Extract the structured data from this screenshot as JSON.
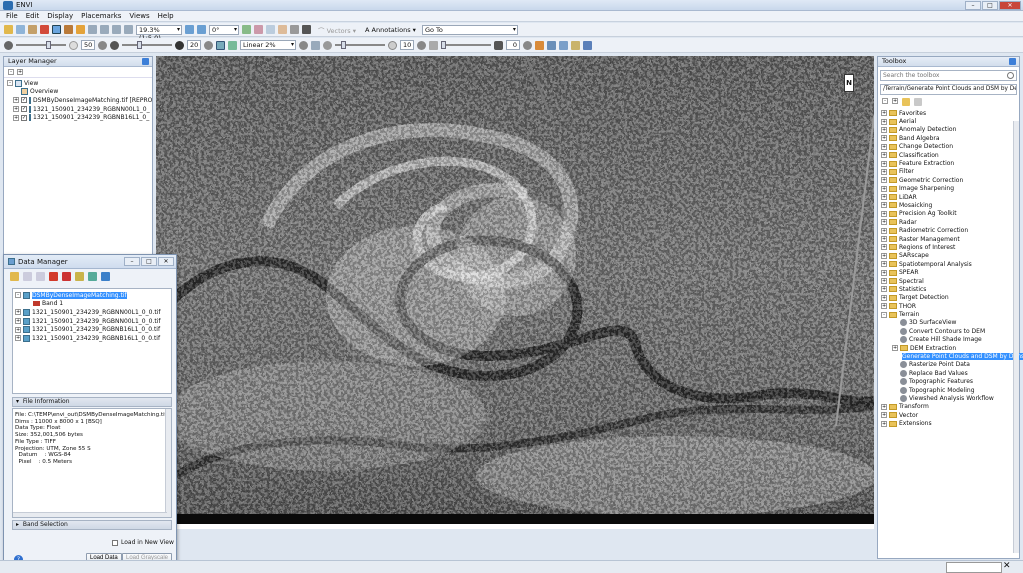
{
  "app": {
    "title": "ENVI"
  },
  "menu": [
    "File",
    "Edit",
    "Display",
    "Placemarks",
    "Views",
    "Help"
  ],
  "toolbar1": {
    "zoom": "19.3% (1:5.0)",
    "rotation": "0°",
    "vectors": "Vectors",
    "annotations": "Annotations",
    "goto": "Go To"
  },
  "toolbar2": {
    "brightness": "50",
    "contrast": "20",
    "stretch": "Linear 2%",
    "sharpen": "10",
    "transparency": "0"
  },
  "layer_manager": {
    "title": "Layer Manager",
    "items": [
      {
        "label": "View"
      },
      {
        "label": "Overview"
      },
      {
        "label": "DSMByDenseImageMatching.tif [REPRO"
      },
      {
        "label": "1321_150901_234239_RGBNN00L1_0_"
      },
      {
        "label": "1321_150901_234239_RGBNB16L1_0_"
      }
    ]
  },
  "data_manager": {
    "title": "Data Manager",
    "items": [
      {
        "label": "DSMByDenseImageMatching.tif"
      },
      {
        "label": "Band 1"
      },
      {
        "label": "1321_150901_234239_RGBNN00L1_0_0.tif"
      },
      {
        "label": "1321_150901_234239_RGBNN00L1_0_0.tif"
      },
      {
        "label": "1321_150901_234239_RGBNB16L1_0_0.tif"
      },
      {
        "label": "1321_150901_234239_RGBNB16L1_0_0.tif"
      }
    ],
    "file_info_header": "File Information",
    "file_info": [
      "File: C:\\TEMP\\envi_out\\DSMByDenseImageMatching.tif",
      "Dims : 11000 x 8000 x 1 [BSQ]",
      "Data Type: Float",
      "Size: 352,001,506 bytes",
      "File Type : TIFF",
      "Projection: UTM, Zone 55 S",
      "  Datum    : WGS-84",
      "  Pixel    : 0.5 Meters"
    ],
    "band_selection": "Band Selection",
    "load_new_view": "Load in New View",
    "load_data": "Load Data",
    "load_grayscale": "Load Grayscale"
  },
  "north": "N",
  "toolbox": {
    "title": "Toolbox",
    "search_placeholder": "Search the toolbox",
    "path": "/Terrain/Generate Point Clouds and DSM by Dense Im",
    "items": [
      {
        "label": "Favorites",
        "type": "folder",
        "level": 0
      },
      {
        "label": "Aerial",
        "type": "folder",
        "level": 0
      },
      {
        "label": "Anomaly Detection",
        "type": "folder",
        "level": 0
      },
      {
        "label": "Band Algebra",
        "type": "folder",
        "level": 0
      },
      {
        "label": "Change Detection",
        "type": "folder",
        "level": 0
      },
      {
        "label": "Classification",
        "type": "folder",
        "level": 0
      },
      {
        "label": "Feature Extraction",
        "type": "folder",
        "level": 0
      },
      {
        "label": "Filter",
        "type": "folder",
        "level": 0
      },
      {
        "label": "Geometric Correction",
        "type": "folder",
        "level": 0
      },
      {
        "label": "Image Sharpening",
        "type": "folder",
        "level": 0
      },
      {
        "label": "LiDAR",
        "type": "folder",
        "level": 0
      },
      {
        "label": "Mosaicking",
        "type": "folder",
        "level": 0
      },
      {
        "label": "Precision Ag Toolkit",
        "type": "folder",
        "level": 0
      },
      {
        "label": "Radar",
        "type": "folder",
        "level": 0
      },
      {
        "label": "Radiometric Correction",
        "type": "folder",
        "level": 0
      },
      {
        "label": "Raster Management",
        "type": "folder",
        "level": 0
      },
      {
        "label": "Regions of Interest",
        "type": "folder",
        "level": 0
      },
      {
        "label": "SARscape",
        "type": "folder",
        "level": 0
      },
      {
        "label": "Spatiotemporal Analysis",
        "type": "folder",
        "level": 0
      },
      {
        "label": "SPEAR",
        "type": "folder",
        "level": 0
      },
      {
        "label": "Spectral",
        "type": "folder",
        "level": 0
      },
      {
        "label": "Statistics",
        "type": "folder",
        "level": 0
      },
      {
        "label": "Target Detection",
        "type": "folder",
        "level": 0
      },
      {
        "label": "THOR",
        "type": "folder",
        "level": 0
      },
      {
        "label": "Terrain",
        "type": "folder",
        "level": 0
      },
      {
        "label": "3D SurfaceView",
        "type": "tool",
        "level": 1
      },
      {
        "label": "Convert Contours to DEM",
        "type": "tool",
        "level": 1
      },
      {
        "label": "Create Hill Shade Image",
        "type": "tool",
        "level": 1
      },
      {
        "label": "DEM Extraction",
        "type": "folder",
        "level": 1
      },
      {
        "label": "Generate Point Clouds and DSM by Dense",
        "type": "tool",
        "level": 1,
        "selected": true
      },
      {
        "label": "Rasterize Point Data",
        "type": "tool",
        "level": 1
      },
      {
        "label": "Replace Bad Values",
        "type": "tool",
        "level": 1
      },
      {
        "label": "Topographic Features",
        "type": "tool",
        "level": 1
      },
      {
        "label": "Topographic Modeling",
        "type": "tool",
        "level": 1
      },
      {
        "label": "Viewshed Analysis Workflow",
        "type": "tool",
        "level": 1
      },
      {
        "label": "Transform",
        "type": "folder",
        "level": 0
      },
      {
        "label": "Vector",
        "type": "folder",
        "level": 0
      },
      {
        "label": "Extensions",
        "type": "folder",
        "level": 0
      }
    ]
  },
  "colors": {
    "accent": "#3390ff",
    "folder": "#e9c35a",
    "titlebar": "#c9d8ec"
  }
}
